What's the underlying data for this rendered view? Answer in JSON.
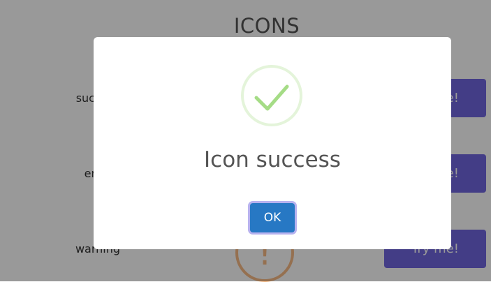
{
  "page": {
    "title": "ICONS",
    "rows": [
      {
        "label": "success",
        "button_label": "Try me!"
      },
      {
        "label": "error",
        "button_label": "Try me!"
      },
      {
        "label": "warning",
        "button_label": "Try me!",
        "icon_glyph": "!"
      }
    ]
  },
  "modal": {
    "icon": "checkmark-icon",
    "title": "Icon success",
    "ok_label": "OK"
  },
  "colors": {
    "overlay": "rgba(0,0,0,0.4)",
    "success": "#a5dc86",
    "warning": "#f8bb86",
    "try_button": "#7066e0",
    "ok_button": "#2778c4"
  }
}
